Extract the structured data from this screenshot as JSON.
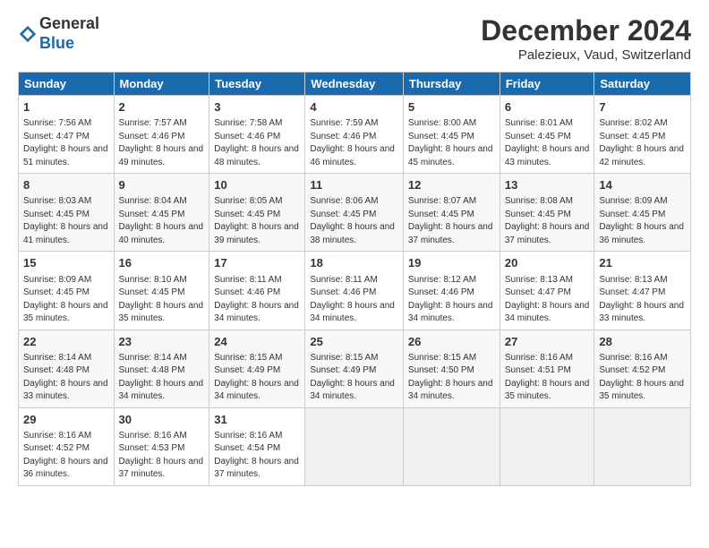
{
  "logo": {
    "general": "General",
    "blue": "Blue"
  },
  "title": "December 2024",
  "location": "Palezieux, Vaud, Switzerland",
  "days_of_week": [
    "Sunday",
    "Monday",
    "Tuesday",
    "Wednesday",
    "Thursday",
    "Friday",
    "Saturday"
  ],
  "weeks": [
    [
      {
        "day": "1",
        "sunrise": "7:56 AM",
        "sunset": "4:47 PM",
        "daylight": "8 hours and 51 minutes."
      },
      {
        "day": "2",
        "sunrise": "7:57 AM",
        "sunset": "4:46 PM",
        "daylight": "8 hours and 49 minutes."
      },
      {
        "day": "3",
        "sunrise": "7:58 AM",
        "sunset": "4:46 PM",
        "daylight": "8 hours and 48 minutes."
      },
      {
        "day": "4",
        "sunrise": "7:59 AM",
        "sunset": "4:46 PM",
        "daylight": "8 hours and 46 minutes."
      },
      {
        "day": "5",
        "sunrise": "8:00 AM",
        "sunset": "4:45 PM",
        "daylight": "8 hours and 45 minutes."
      },
      {
        "day": "6",
        "sunrise": "8:01 AM",
        "sunset": "4:45 PM",
        "daylight": "8 hours and 43 minutes."
      },
      {
        "day": "7",
        "sunrise": "8:02 AM",
        "sunset": "4:45 PM",
        "daylight": "8 hours and 42 minutes."
      }
    ],
    [
      {
        "day": "8",
        "sunrise": "8:03 AM",
        "sunset": "4:45 PM",
        "daylight": "8 hours and 41 minutes."
      },
      {
        "day": "9",
        "sunrise": "8:04 AM",
        "sunset": "4:45 PM",
        "daylight": "8 hours and 40 minutes."
      },
      {
        "day": "10",
        "sunrise": "8:05 AM",
        "sunset": "4:45 PM",
        "daylight": "8 hours and 39 minutes."
      },
      {
        "day": "11",
        "sunrise": "8:06 AM",
        "sunset": "4:45 PM",
        "daylight": "8 hours and 38 minutes."
      },
      {
        "day": "12",
        "sunrise": "8:07 AM",
        "sunset": "4:45 PM",
        "daylight": "8 hours and 37 minutes."
      },
      {
        "day": "13",
        "sunrise": "8:08 AM",
        "sunset": "4:45 PM",
        "daylight": "8 hours and 37 minutes."
      },
      {
        "day": "14",
        "sunrise": "8:09 AM",
        "sunset": "4:45 PM",
        "daylight": "8 hours and 36 minutes."
      }
    ],
    [
      {
        "day": "15",
        "sunrise": "8:09 AM",
        "sunset": "4:45 PM",
        "daylight": "8 hours and 35 minutes."
      },
      {
        "day": "16",
        "sunrise": "8:10 AM",
        "sunset": "4:45 PM",
        "daylight": "8 hours and 35 minutes."
      },
      {
        "day": "17",
        "sunrise": "8:11 AM",
        "sunset": "4:46 PM",
        "daylight": "8 hours and 34 minutes."
      },
      {
        "day": "18",
        "sunrise": "8:11 AM",
        "sunset": "4:46 PM",
        "daylight": "8 hours and 34 minutes."
      },
      {
        "day": "19",
        "sunrise": "8:12 AM",
        "sunset": "4:46 PM",
        "daylight": "8 hours and 34 minutes."
      },
      {
        "day": "20",
        "sunrise": "8:13 AM",
        "sunset": "4:47 PM",
        "daylight": "8 hours and 34 minutes."
      },
      {
        "day": "21",
        "sunrise": "8:13 AM",
        "sunset": "4:47 PM",
        "daylight": "8 hours and 33 minutes."
      }
    ],
    [
      {
        "day": "22",
        "sunrise": "8:14 AM",
        "sunset": "4:48 PM",
        "daylight": "8 hours and 33 minutes."
      },
      {
        "day": "23",
        "sunrise": "8:14 AM",
        "sunset": "4:48 PM",
        "daylight": "8 hours and 34 minutes."
      },
      {
        "day": "24",
        "sunrise": "8:15 AM",
        "sunset": "4:49 PM",
        "daylight": "8 hours and 34 minutes."
      },
      {
        "day": "25",
        "sunrise": "8:15 AM",
        "sunset": "4:49 PM",
        "daylight": "8 hours and 34 minutes."
      },
      {
        "day": "26",
        "sunrise": "8:15 AM",
        "sunset": "4:50 PM",
        "daylight": "8 hours and 34 minutes."
      },
      {
        "day": "27",
        "sunrise": "8:16 AM",
        "sunset": "4:51 PM",
        "daylight": "8 hours and 35 minutes."
      },
      {
        "day": "28",
        "sunrise": "8:16 AM",
        "sunset": "4:52 PM",
        "daylight": "8 hours and 35 minutes."
      }
    ],
    [
      {
        "day": "29",
        "sunrise": "8:16 AM",
        "sunset": "4:52 PM",
        "daylight": "8 hours and 36 minutes."
      },
      {
        "day": "30",
        "sunrise": "8:16 AM",
        "sunset": "4:53 PM",
        "daylight": "8 hours and 37 minutes."
      },
      {
        "day": "31",
        "sunrise": "8:16 AM",
        "sunset": "4:54 PM",
        "daylight": "8 hours and 37 minutes."
      },
      null,
      null,
      null,
      null
    ]
  ],
  "labels": {
    "sunrise": "Sunrise:",
    "sunset": "Sunset:",
    "daylight": "Daylight:"
  }
}
